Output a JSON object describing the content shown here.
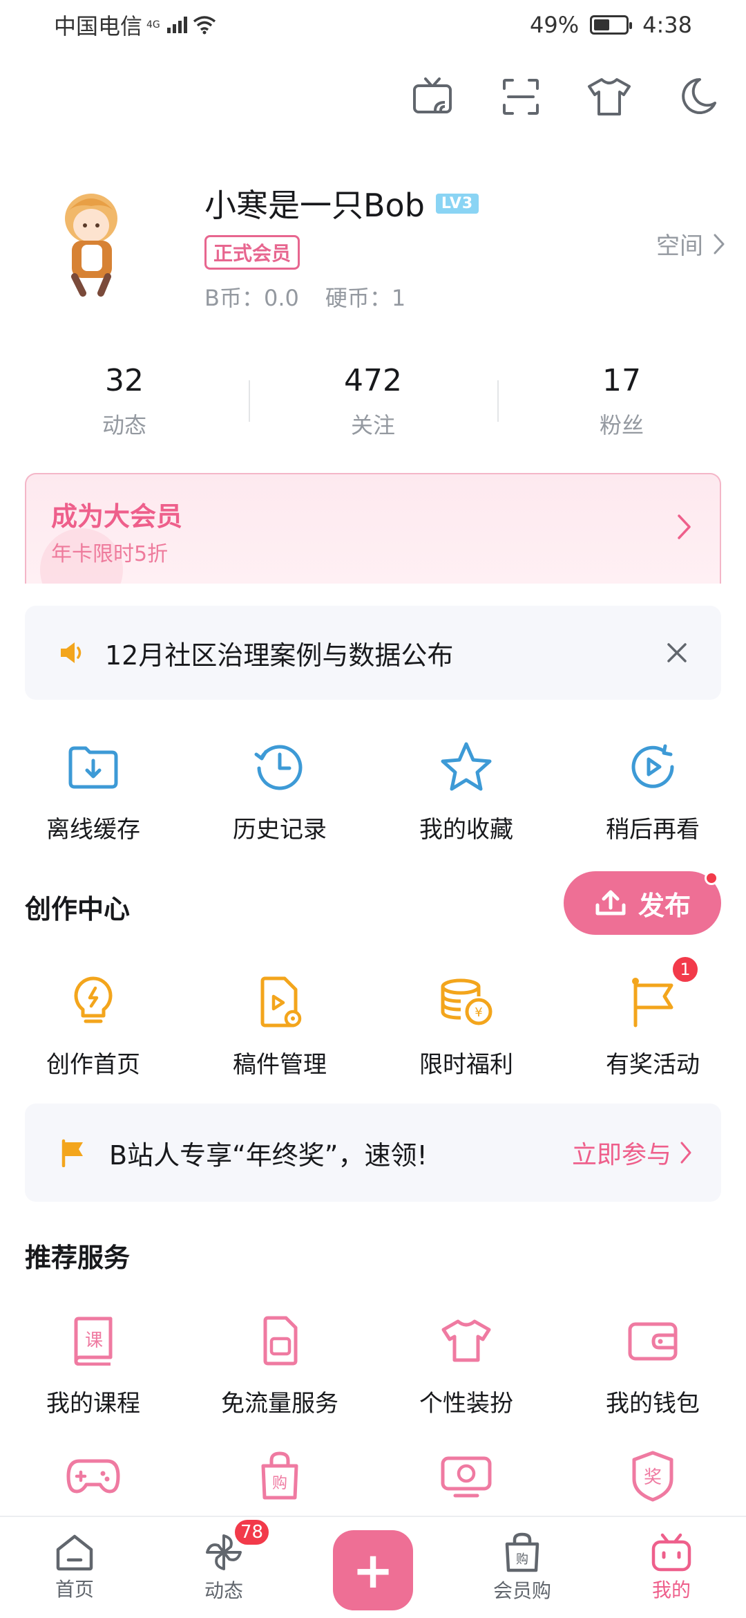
{
  "status_bar": {
    "carrier": "中国电信",
    "network": "4G",
    "battery": "49%",
    "time": "4:38"
  },
  "toolbar": {
    "icons": [
      "tv-cast-icon",
      "scan-icon",
      "theme-shirt-icon",
      "night-mode-icon"
    ]
  },
  "profile": {
    "username": "小寒是一只Bob",
    "level": "LV3",
    "vip_badge": "正式会员",
    "coins_b": "B币：0.0",
    "coins_hard": "硬币：1",
    "space_link": "空间"
  },
  "stats": [
    {
      "value": "32",
      "label": "动态"
    },
    {
      "value": "472",
      "label": "关注"
    },
    {
      "value": "17",
      "label": "粉丝"
    }
  ],
  "vip_banner": {
    "title": "成为大会员",
    "subtitle": "年卡限时5折"
  },
  "notice": {
    "text": "12月社区治理案例与数据公布"
  },
  "quick_actions": [
    {
      "label": "离线缓存",
      "icon": "download-folder-icon"
    },
    {
      "label": "历史记录",
      "icon": "history-clock-icon"
    },
    {
      "label": "我的收藏",
      "icon": "star-icon"
    },
    {
      "label": "稍后再看",
      "icon": "watch-later-icon"
    }
  ],
  "creation": {
    "title": "创作中心",
    "publish_label": "发布",
    "items": [
      {
        "label": "创作首页",
        "icon": "lightbulb-icon"
      },
      {
        "label": "稿件管理",
        "icon": "manuscript-icon"
      },
      {
        "label": "限时福利",
        "icon": "coins-icon"
      },
      {
        "label": "有奖活动",
        "icon": "flag-icon",
        "badge": "1"
      }
    ]
  },
  "promo": {
    "text": "B站人专享“年终奖”，速领!",
    "action": "立即参与"
  },
  "services": {
    "title": "推荐服务",
    "items": [
      {
        "label": "我的课程",
        "icon": "course-book-icon"
      },
      {
        "label": "免流量服务",
        "icon": "sim-card-icon"
      },
      {
        "label": "个性装扮",
        "icon": "shirt-icon"
      },
      {
        "label": "我的钱包",
        "icon": "wallet-icon"
      }
    ],
    "more_icons": [
      "gamepad-icon",
      "shopping-bag-icon",
      "tv-screen-icon",
      "award-icon"
    ]
  },
  "bottom_nav": {
    "items": [
      {
        "label": "首页",
        "icon": "home-icon"
      },
      {
        "label": "动态",
        "icon": "pinwheel-icon",
        "badge": "78"
      },
      {
        "label": "",
        "icon": "plus-icon"
      },
      {
        "label": "会员购",
        "icon": "shopping-bag-icon"
      },
      {
        "label": "我的",
        "icon": "tv-mascot-icon"
      }
    ],
    "active": "我的"
  },
  "colors": {
    "accent": "#ee6f95",
    "accent_text": "#ee5f8b",
    "blue_icons": "#3d9ad6",
    "orange_icons": "#f3a51c",
    "pink_icons": "#ef7aa1",
    "muted_text": "#9499a0"
  }
}
